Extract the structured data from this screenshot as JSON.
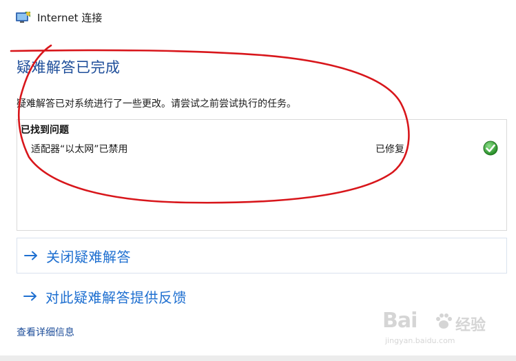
{
  "window": {
    "title": "Internet 连接",
    "icon": "network-connection-icon"
  },
  "main": {
    "heading": "疑难解答已完成",
    "description": "疑难解答已对系统进行了一些更改。请尝试之前尝试执行的任务。"
  },
  "issues": {
    "title": "已找到问题",
    "items": [
      {
        "name": "适配器“以太网”已禁用",
        "status": "已修复",
        "status_icon": "green-check-icon"
      }
    ]
  },
  "actions": [
    {
      "label": "关闭疑难解答",
      "icon": "arrow-right-icon"
    },
    {
      "label": "对此疑难解答提供反馈",
      "icon": "arrow-right-icon"
    }
  ],
  "details_link": "查看详细信息",
  "watermark": {
    "brand": "Bai",
    "product": "经验",
    "domain": "jingyan.baidu.com"
  },
  "colors": {
    "heading": "#1e4e9a",
    "link": "#1e6fd0",
    "annotation": "#d8161b",
    "check": "#2fa52f"
  }
}
